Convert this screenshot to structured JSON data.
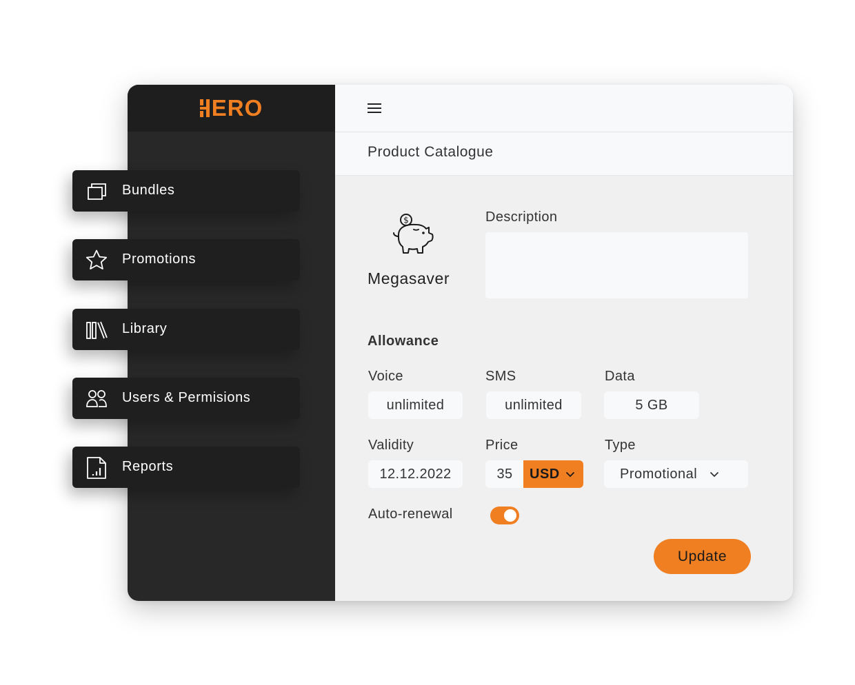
{
  "brand": {
    "logo_text": "ERO",
    "accent_color": "#f07f22"
  },
  "topbar": {
    "menu_icon": "hamburger-menu-icon"
  },
  "page": {
    "title": "Product Catalogue"
  },
  "nav": {
    "items": [
      {
        "label": "Bundles",
        "icon": "bundles-icon"
      },
      {
        "label": "Promotions",
        "icon": "star-icon"
      },
      {
        "label": "Library",
        "icon": "library-icon"
      },
      {
        "label": "Users & Permisions",
        "icon": "users-icon"
      },
      {
        "label": "Reports",
        "icon": "reports-icon"
      }
    ]
  },
  "product": {
    "name": "Megasaver",
    "icon": "piggy-bank-icon",
    "description_label": "Description",
    "description_value": ""
  },
  "allowance": {
    "title": "Allowance",
    "voice": {
      "label": "Voice",
      "value": "unlimited"
    },
    "sms": {
      "label": "SMS",
      "value": "unlimited"
    },
    "data": {
      "label": "Data",
      "value": "5 GB"
    }
  },
  "validity": {
    "label": "Validity",
    "value": "12.12.2022"
  },
  "price": {
    "label": "Price",
    "value": "35",
    "currency": "USD"
  },
  "type": {
    "label": "Type",
    "value": "Promotional"
  },
  "auto_renewal": {
    "label": "Auto-renewal",
    "enabled": true
  },
  "actions": {
    "update_label": "Update"
  }
}
